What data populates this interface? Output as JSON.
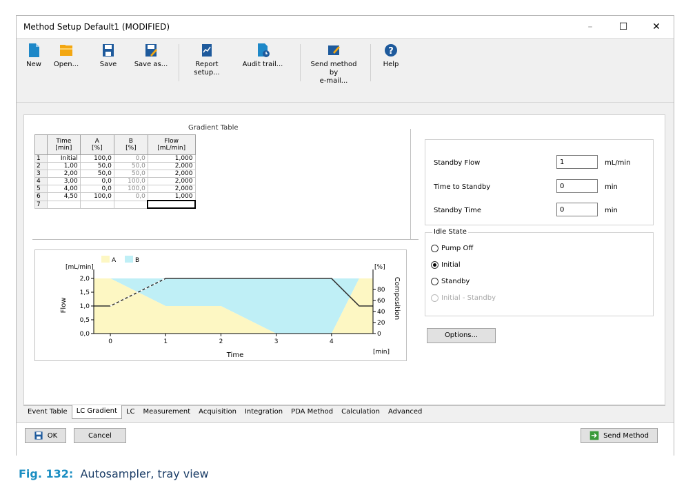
{
  "window": {
    "title": "Method Setup Default1 (MODIFIED)"
  },
  "ribbon": {
    "new": "New",
    "open": "Open...",
    "save": "Save",
    "save_as": "Save as...",
    "report_setup": "Report setup...",
    "audit_trail": "Audit trail...",
    "send_email_line1": "Send method by",
    "send_email_line2": "e-mail...",
    "help": "Help"
  },
  "gradient_table": {
    "label": "Gradient Table",
    "headers": [
      {
        "l1": "Time",
        "l2": "[min]"
      },
      {
        "l1": "A",
        "l2": "[%]"
      },
      {
        "l1": "B",
        "l2": "[%]"
      },
      {
        "l1": "Flow",
        "l2": "[mL/min]"
      }
    ],
    "rows": [
      {
        "n": "1",
        "time": "Initial",
        "a": "100,0",
        "b": "0,0",
        "flow": "1,000"
      },
      {
        "n": "2",
        "time": "1,00",
        "a": "50,0",
        "b": "50,0",
        "flow": "2,000"
      },
      {
        "n": "3",
        "time": "2,00",
        "a": "50,0",
        "b": "50,0",
        "flow": "2,000"
      },
      {
        "n": "4",
        "time": "3,00",
        "a": "0,0",
        "b": "100,0",
        "flow": "2,000"
      },
      {
        "n": "5",
        "time": "4,00",
        "a": "0,0",
        "b": "100,0",
        "flow": "2,000"
      },
      {
        "n": "6",
        "time": "4,50",
        "a": "100,0",
        "b": "0,0",
        "flow": "1,000"
      },
      {
        "n": "7",
        "time": "",
        "a": "",
        "b": "",
        "flow": ""
      }
    ]
  },
  "chart_data": {
    "type": "area",
    "xlabel": "Time",
    "x_unit": "[min]",
    "y_left_label": "Flow",
    "y_left_unit": "[mL/min]",
    "y_right_label": "Composition",
    "y_right_unit": "[%]",
    "xlim": [
      -0.3,
      4.75
    ],
    "ylim_left": [
      0,
      2.25
    ],
    "ylim_right": [
      0,
      112.5
    ],
    "x_ticks": [
      "0",
      "1",
      "2",
      "3",
      "4"
    ],
    "y_left_ticks": [
      "0,0",
      "0,5",
      "1,0",
      "1,5",
      "2,0"
    ],
    "y_right_ticks": [
      "0",
      "20",
      "40",
      "60",
      "80"
    ],
    "legend": [
      {
        "name": "A",
        "color": "#fdf7c3"
      },
      {
        "name": "B",
        "color": "#bfeff6"
      }
    ],
    "time": [
      0,
      1,
      2,
      3,
      4,
      4.5
    ],
    "series": [
      {
        "name": "A",
        "values": [
          100,
          50,
          50,
          0,
          0,
          100
        ]
      },
      {
        "name": "B",
        "values": [
          0,
          50,
          50,
          100,
          100,
          0
        ]
      }
    ],
    "flow": [
      1.0,
      2.0,
      2.0,
      2.0,
      2.0,
      1.0
    ],
    "flow_pre": [
      -0.3,
      1.0
    ],
    "flow_post": [
      4.75,
      1.0
    ]
  },
  "standby": {
    "flow_label": "Standby Flow",
    "flow_value": "1",
    "flow_unit": "mL/min",
    "time_to_label": "Time to Standby",
    "time_to_value": "0",
    "time_to_unit": "min",
    "time_label": "Standby Time",
    "time_value": "0",
    "time_unit": "min"
  },
  "idle": {
    "legend": "Idle State",
    "options": [
      "Pump Off",
      "Initial",
      "Standby",
      "Initial - Standby"
    ],
    "selected": "Initial"
  },
  "options_button": "Options...",
  "tabs": [
    "Event Table",
    "LC Gradient",
    "LC",
    "Measurement",
    "Acquisition",
    "Integration",
    "PDA Method",
    "Calculation",
    "Advanced"
  ],
  "active_tab": "LC Gradient",
  "bottom": {
    "ok": "OK",
    "cancel": "Cancel",
    "send": "Send Method"
  },
  "caption": {
    "fig": "Fig. 132:",
    "text": "Autosampler, tray view"
  },
  "colors": {
    "area_a": "#fdf7c3",
    "area_b": "#bfeff6",
    "flow_line": "#333333",
    "caption_fig": "#1b8ec2",
    "caption_text": "#1a3c66"
  }
}
